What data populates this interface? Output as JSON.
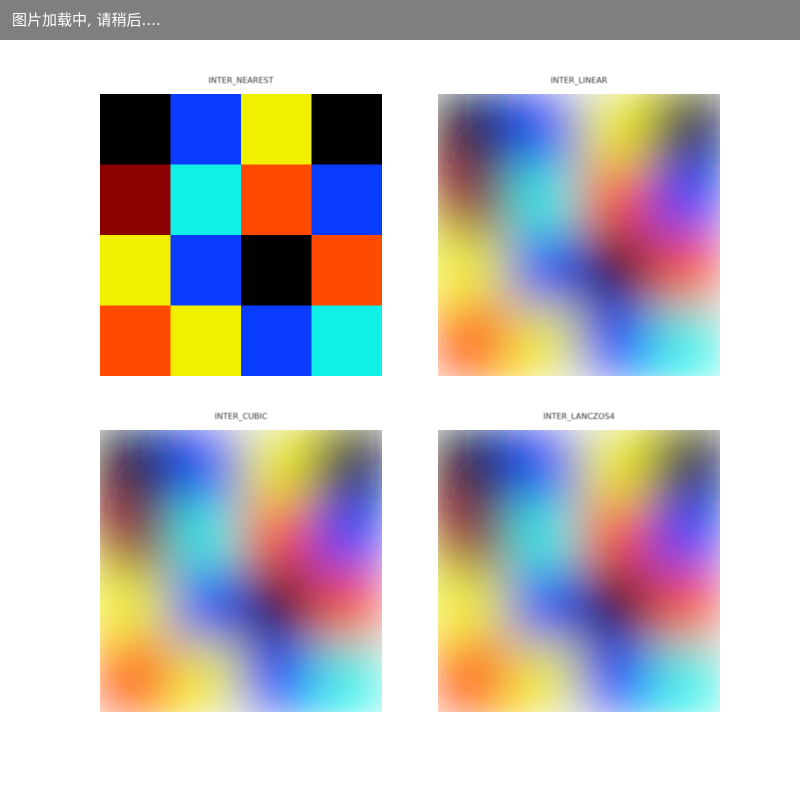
{
  "banner": {
    "text": "图片加载中, 请稍后...."
  },
  "panels": [
    {
      "title": "INTER_NEAREST",
      "mode": "nearest",
      "colors": [
        [
          "#000000",
          "#0a3cff",
          "#f0f000",
          "#000000"
        ],
        [
          "#8b0000",
          "#10f0e6",
          "#ff4a00",
          "#0a3cff"
        ],
        [
          "#f0f000",
          "#0a3cff",
          "#000000",
          "#ff4a00"
        ],
        [
          "#ff4a00",
          "#f0f000",
          "#0a3cff",
          "#10f0e6"
        ]
      ]
    },
    {
      "title": "INTER_LINEAR",
      "mode": "smooth",
      "colors": [
        [
          "#000000",
          "#0a3cff",
          "#f0f000",
          "#000000"
        ],
        [
          "#8b0000",
          "#10f0e6",
          "#ff4a00",
          "#0a3cff"
        ],
        [
          "#f0f000",
          "#0a3cff",
          "#000000",
          "#ff4a00"
        ],
        [
          "#ff4a00",
          "#f0f000",
          "#0a3cff",
          "#10f0e6"
        ]
      ]
    },
    {
      "title": "INTER_CUBIC",
      "mode": "smooth",
      "colors": [
        [
          "#000000",
          "#0a3cff",
          "#f0f000",
          "#000000"
        ],
        [
          "#8b0000",
          "#10f0e6",
          "#ff4a00",
          "#0a3cff"
        ],
        [
          "#f0f000",
          "#0a3cff",
          "#000000",
          "#ff4a00"
        ],
        [
          "#ff4a00",
          "#f0f000",
          "#0a3cff",
          "#10f0e6"
        ]
      ]
    },
    {
      "title": "INTER_LANCZOS4",
      "mode": "smooth",
      "colors": [
        [
          "#000000",
          "#0a3cff",
          "#f0f000",
          "#000000"
        ],
        [
          "#8b0000",
          "#10f0e6",
          "#ff4a00",
          "#0a3cff"
        ],
        [
          "#f0f000",
          "#0a3cff",
          "#000000",
          "#ff4a00"
        ],
        [
          "#ff4a00",
          "#f0f000",
          "#0a3cff",
          "#10f0e6"
        ]
      ]
    }
  ]
}
